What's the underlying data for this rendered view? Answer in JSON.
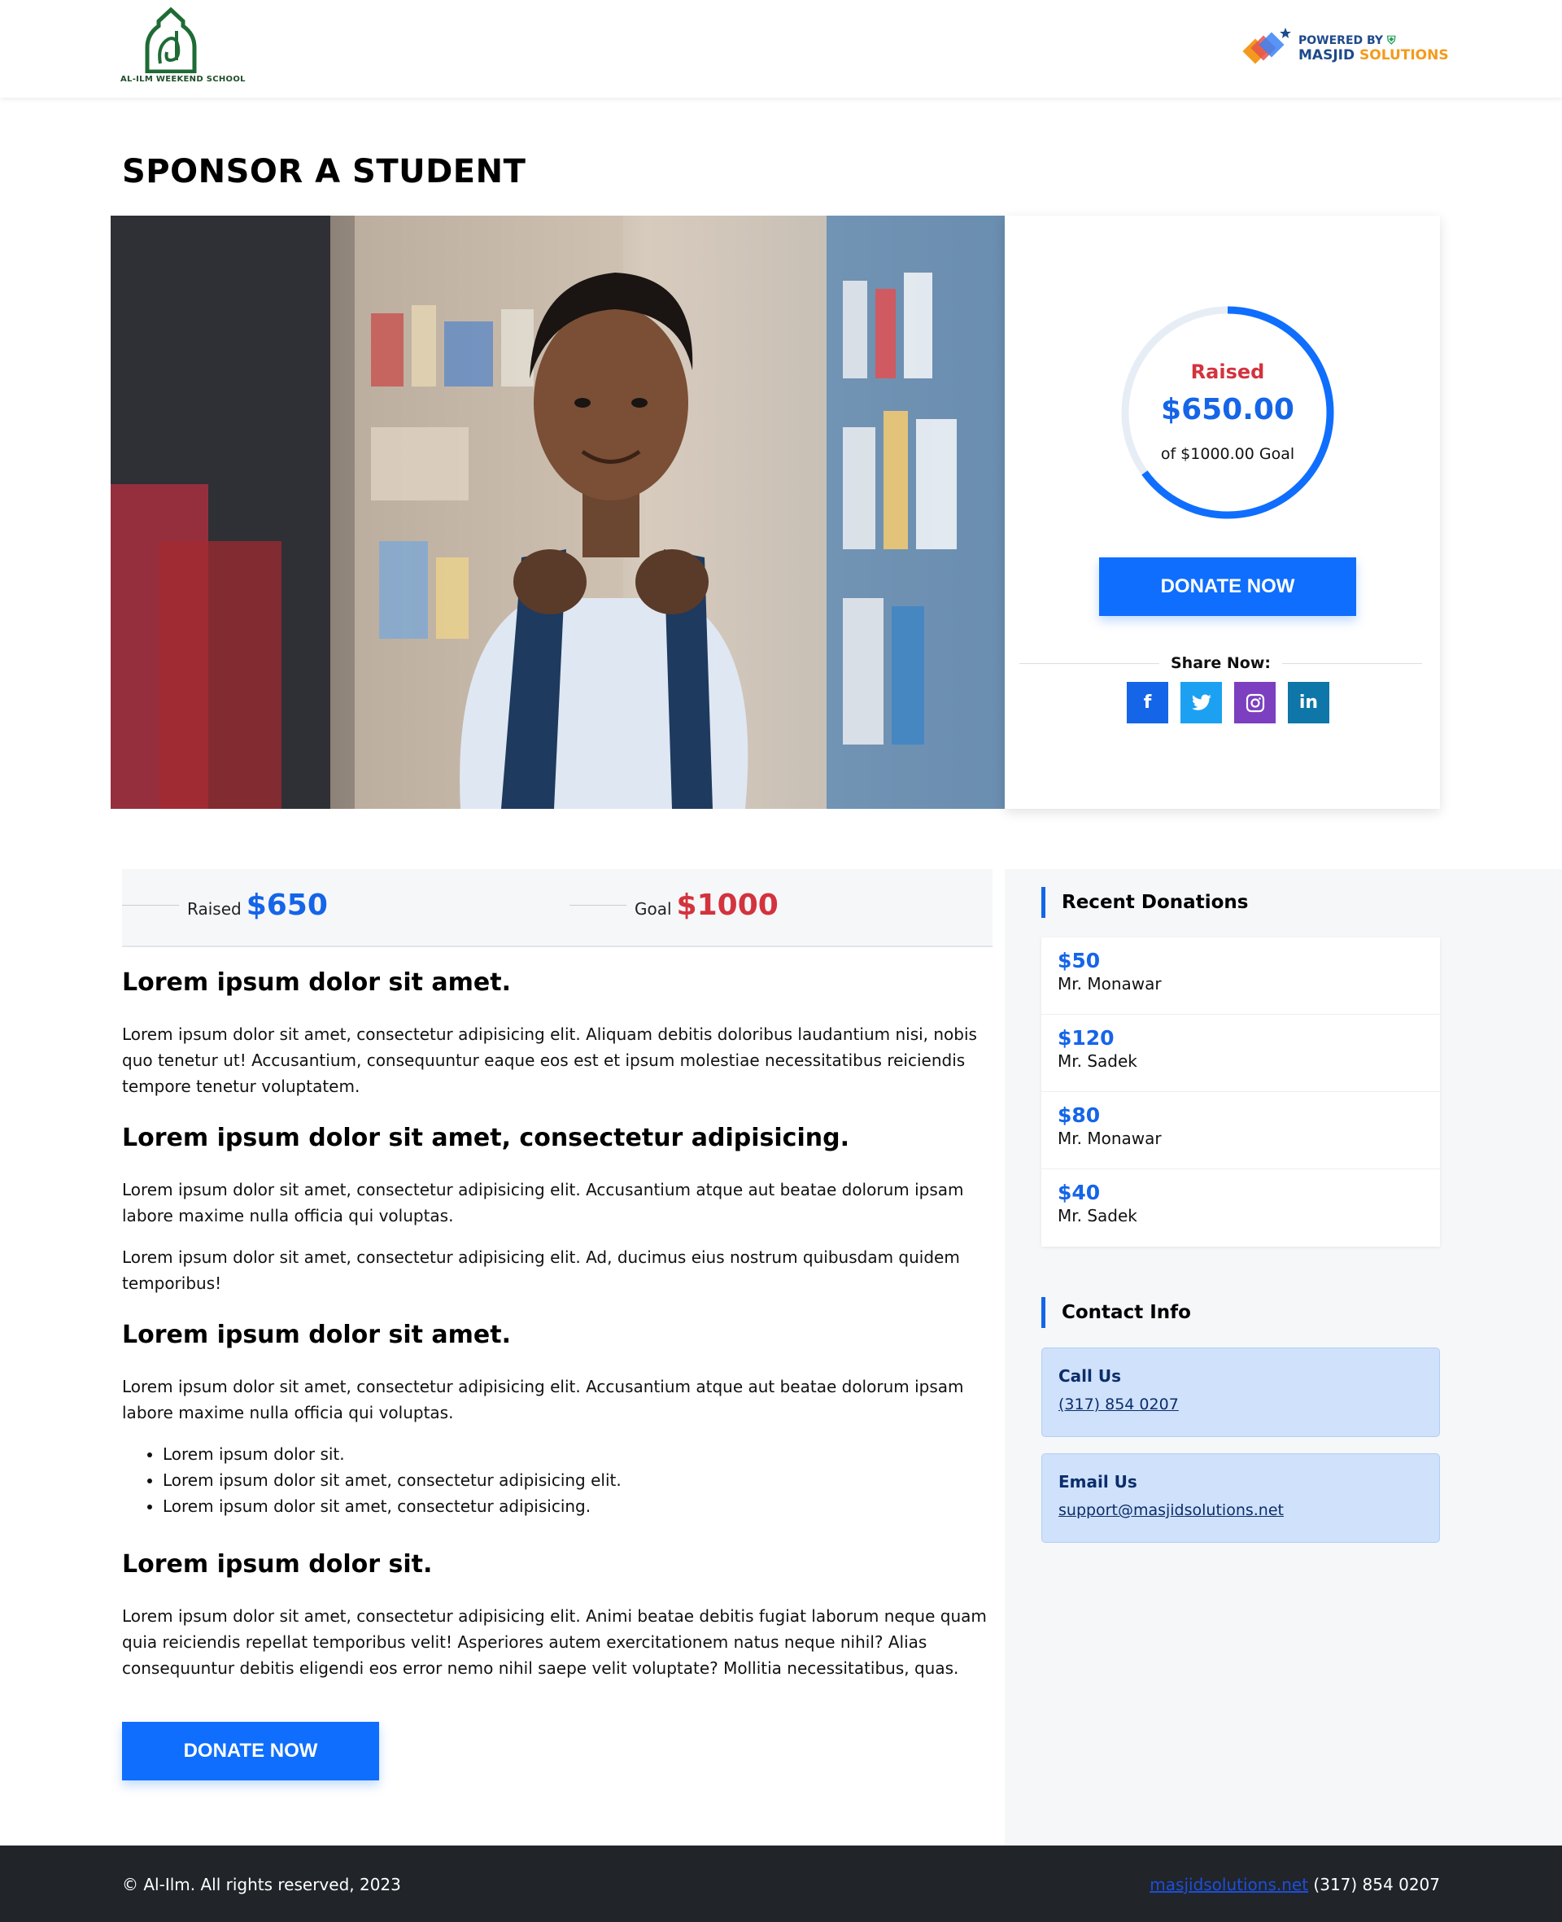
{
  "header": {
    "logo_text": "AL-ILM WEEKEND SCHOOL",
    "powered_by": "POWERED BY",
    "brand_primary": "MASJID",
    "brand_secondary": "SOLUTIONS"
  },
  "page_title": "SPONSOR A STUDENT",
  "campaign": {
    "raised_label": "Raised",
    "raised_amount": "$650.00",
    "goal_text": "of $1000.00 Goal",
    "progress_fraction": 0.65,
    "donate_label": "DONATE NOW",
    "share_label": "Share Now:",
    "socials": [
      "facebook-icon",
      "twitter-icon",
      "instagram-icon",
      "linkedin-icon"
    ]
  },
  "stats": {
    "raised_label": "Raised",
    "raised_value": "$650",
    "goal_label": "Goal",
    "goal_value": "$1000"
  },
  "content": {
    "heading_1": "Lorem ipsum dolor sit amet.",
    "para_1": "Lorem ipsum dolor sit amet, consectetur adipisicing elit. Aliquam debitis doloribus laudantium nisi, nobis quo tenetur ut! Accusantium, consequuntur eaque eos est et ipsum molestiae necessitatibus reiciendis tempore tenetur voluptatem.",
    "heading_2": "Lorem ipsum dolor sit amet, consectetur adipisicing.",
    "para_2": "Lorem ipsum dolor sit amet, consectetur adipisicing elit. Accusantium atque aut beatae dolorum ipsam labore maxime nulla officia qui voluptas.",
    "para_3": "Lorem ipsum dolor sit amet, consectetur adipisicing elit. Ad, ducimus eius nostrum quibusdam quidem temporibus!",
    "heading_3": "Lorem ipsum dolor sit amet.",
    "para_4": "Lorem ipsum dolor sit amet, consectetur adipisicing elit. Accusantium atque aut beatae dolorum ipsam labore maxime nulla officia qui voluptas.",
    "list": [
      "Lorem ipsum dolor sit.",
      "Lorem ipsum dolor sit amet, consectetur adipisicing elit.",
      "Lorem ipsum dolor sit amet, consectetur adipisicing."
    ],
    "heading_4": "Lorem ipsum dolor sit.",
    "para_5": "Lorem ipsum dolor sit amet, consectetur adipisicing elit. Animi beatae debitis fugiat laborum neque quam quia reiciendis repellat temporibus velit! Asperiores autem exercitationem natus neque nihil? Alias consequuntur debitis eligendi eos error nemo nihil saepe velit voluptate? Mollitia necessitatibus, quas.",
    "donate_label": "DONATE NOW"
  },
  "sidebar": {
    "recent_title": "Recent Donations",
    "donations": [
      {
        "amount": "$50",
        "name": "Mr. Monawar"
      },
      {
        "amount": "$120",
        "name": "Mr. Sadek"
      },
      {
        "amount": "$80",
        "name": "Mr. Monawar"
      },
      {
        "amount": "$40",
        "name": "Mr. Sadek"
      }
    ],
    "contact_title": "Contact Info",
    "call_label": "Call Us",
    "call_value": "(317) 854 0207",
    "email_label": "Email Us",
    "email_value": "support@masjidsolutions.net"
  },
  "footer": {
    "copyright": "© Al-Ilm. All rights reserved, 2023",
    "link": "masjidsolutions.net",
    "phone": "(317) 854 0207"
  },
  "colors": {
    "accent_blue": "#0f6efd",
    "raised_red": "#d3333d",
    "footer_bg": "#212529"
  }
}
